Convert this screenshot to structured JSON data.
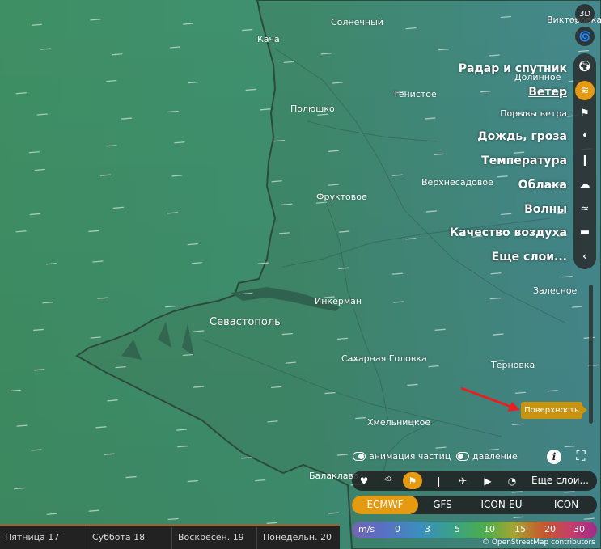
{
  "cities": [
    {
      "name": "Солнечный"
    },
    {
      "name": "Кача"
    },
    {
      "name": "Викторовка"
    },
    {
      "name": "Долинное"
    },
    {
      "name": "Полюшко"
    },
    {
      "name": "Тенистое"
    },
    {
      "name": "Фруктовое"
    },
    {
      "name": "Верхнесадовое"
    },
    {
      "name": "Залесное"
    },
    {
      "name": "Инкерман"
    },
    {
      "name": "Севастополь"
    },
    {
      "name": "Сахарная Головка"
    },
    {
      "name": "Терновка"
    },
    {
      "name": "Хмельницкое"
    },
    {
      "name": "Балаклава"
    }
  ],
  "layers": {
    "btn_3d": "3D",
    "items": [
      {
        "label": "Радар и спутник",
        "icon": "globe-icon"
      },
      {
        "label": "Ветер",
        "icon": "wind-icon",
        "active": true
      },
      {
        "label": "Порывы ветра",
        "icon": "flag-icon"
      },
      {
        "label": "Дождь, гроза",
        "icon": "raindrop-icon"
      },
      {
        "label": "Температура",
        "icon": "thermometer-icon"
      },
      {
        "label": "Облака",
        "icon": "cloud-icon"
      },
      {
        "label": "Волны",
        "icon": "waves-icon"
      },
      {
        "label": "Качество воздуха",
        "icon": "car-icon"
      },
      {
        "label": "Еще слои...",
        "icon": "chevron-left-icon"
      }
    ]
  },
  "surface_tag": "Поверхность",
  "toggles": {
    "particles": "анимация частиц",
    "pressure": "давление"
  },
  "quick_bar": {
    "icons": [
      "heart-icon",
      "sun-cloud-icon",
      "flag-icon",
      "thermometer-icon",
      "plane-icon",
      "camera-icon",
      "webcam-icon"
    ],
    "more_label": "Еще слои..."
  },
  "models": {
    "items": [
      "ECMWF",
      "GFS",
      "ICON-EU",
      "ICON"
    ],
    "active": "ECMWF"
  },
  "legend": {
    "unit": "m/s",
    "values": [
      "0",
      "3",
      "5",
      "10",
      "15",
      "20",
      "30"
    ]
  },
  "attribution": "© OpenStreetMap contributors",
  "timeline": {
    "days": [
      "Пятница 17",
      "Суббота 18",
      "Воскресен. 19",
      "Понедельн. 20"
    ]
  },
  "colors": {
    "accent": "#e49a11",
    "land": "#3f8f6a",
    "sea": "#3d9478"
  }
}
